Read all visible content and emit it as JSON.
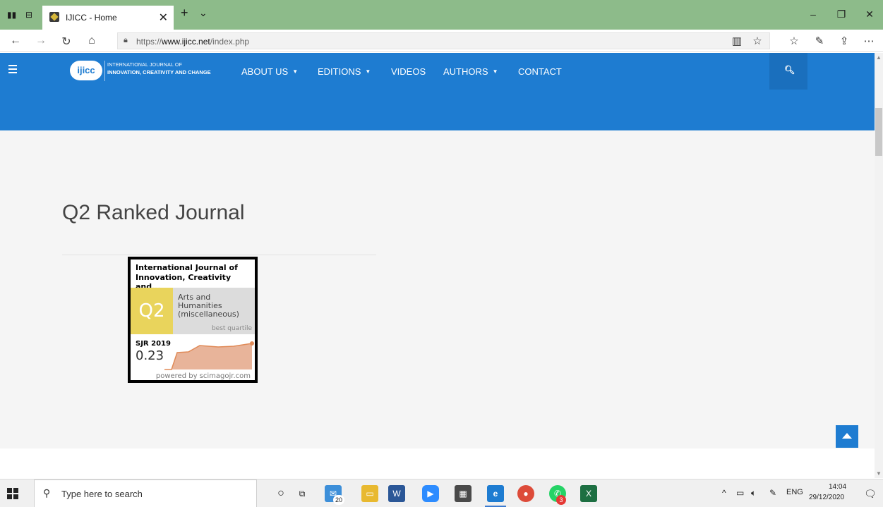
{
  "browser": {
    "tab_title": "IJICC - Home",
    "url_prefix": "https://",
    "url_host": "www.ijicc.net",
    "url_path": "/index.php"
  },
  "site": {
    "logo_text": "ijicc",
    "logo_line1": "INTERNATIONAL JOURNAL OF",
    "logo_line2": "INNOVATION, CREATIVITY AND CHANGE",
    "menu": [
      {
        "label": "ABOUT US",
        "has_dropdown": true
      },
      {
        "label": "EDITIONS",
        "has_dropdown": true
      },
      {
        "label": "VIDEOS",
        "has_dropdown": false
      },
      {
        "label": "AUTHORS",
        "has_dropdown": true
      },
      {
        "label": "CONTACT",
        "has_dropdown": false
      }
    ],
    "accent_color": "#1e7cd1"
  },
  "main": {
    "heading": "Q2 Ranked Journal"
  },
  "sjr_widget": {
    "title_line1": "International Journal of",
    "title_line2": "Innovation, Creativity and...",
    "quartile": "Q2",
    "category_line1": "Arts and",
    "category_line2": "Humanities",
    "category_line3": "(miscellaneous)",
    "best_quartile_label": "best quartile",
    "sjr_label": "SJR 2019",
    "sjr_value": "0.23",
    "powered_by": "powered by scimagojr.com",
    "quartile_color": "#e9d45c",
    "chart_color": "#e8b49a"
  },
  "taskbar": {
    "search_placeholder": "Type here to search",
    "mail_badge": "20",
    "whatsapp_badge": "3",
    "lang": "ENG",
    "time": "14:04",
    "date": "29/12/2020"
  }
}
